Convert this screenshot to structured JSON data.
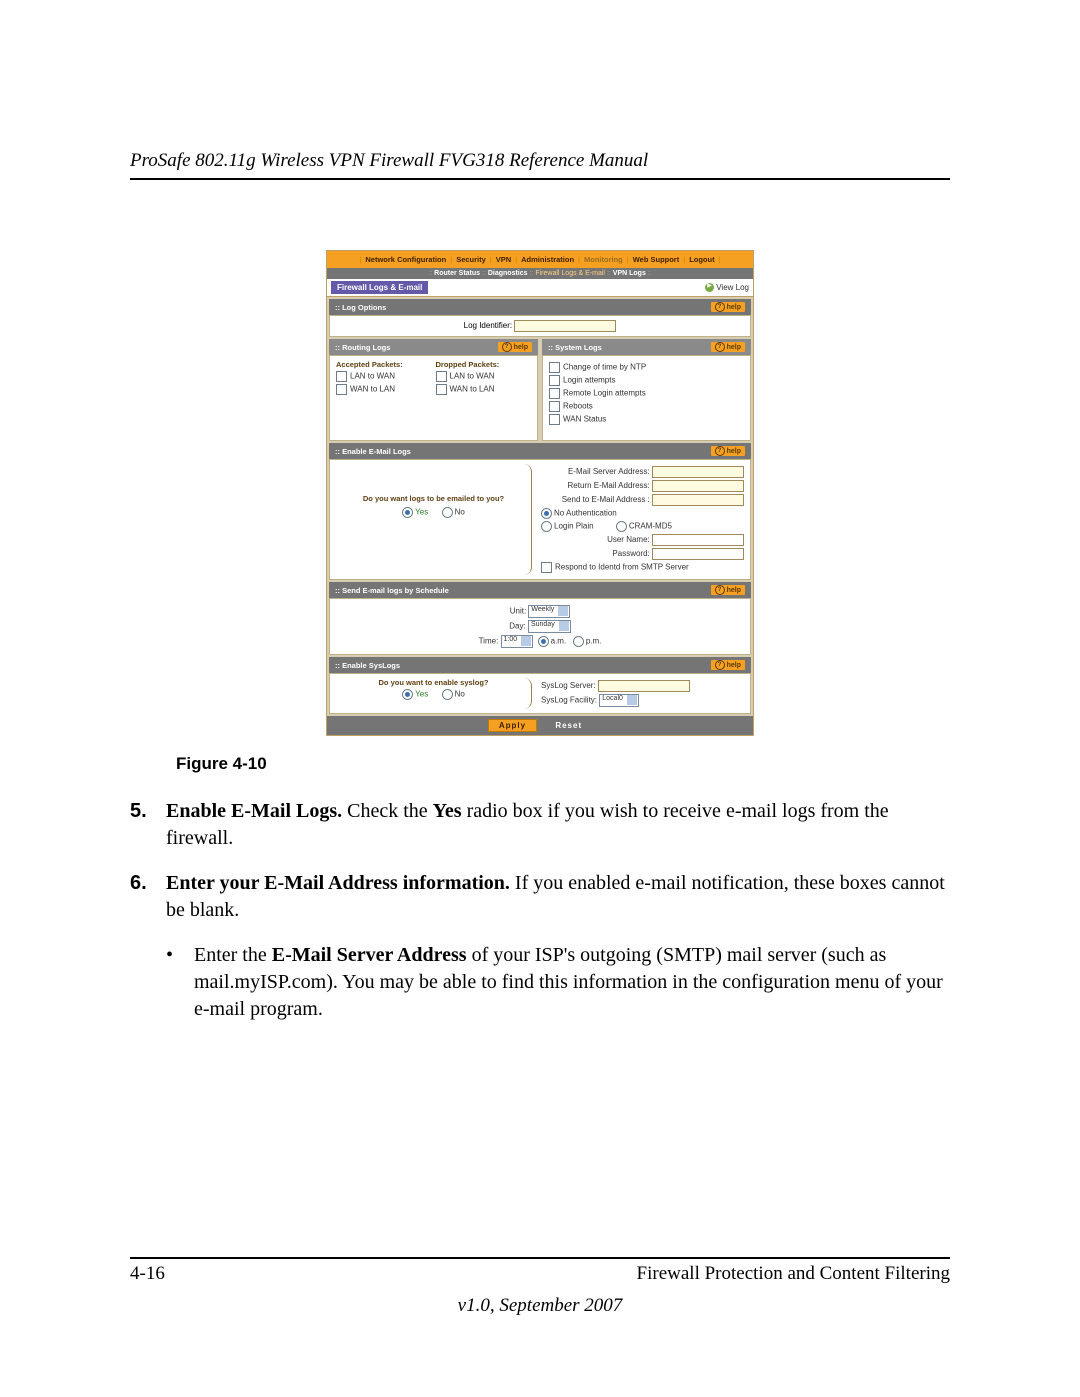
{
  "doc_title": "ProSafe 802.11g Wireless VPN Firewall FVG318 Reference Manual",
  "topnav": {
    "items": [
      "Network Configuration",
      "Security",
      "VPN",
      "Administration",
      "Monitoring",
      "Web Support",
      "Logout"
    ]
  },
  "subnav": {
    "items": [
      "Router Status",
      "Diagnostics",
      "Firewall Logs & E-mail",
      "VPN Logs"
    ]
  },
  "page_title": "Firewall Logs & E-mail",
  "view_log": "View Log",
  "help": "help",
  "section_log_options": {
    "title": "Log Options",
    "label": "Log Identifier:"
  },
  "section_routing": {
    "title": "Routing Logs",
    "col1": "Accepted Packets:",
    "col2": "Dropped Packets:",
    "opt1": "LAN to WAN",
    "opt2": "WAN to LAN"
  },
  "section_system": {
    "title": "System Logs",
    "o1": "Change of time by NTP",
    "o2": "Login attempts",
    "o3": "Remote Login attempts",
    "o4": "Reboots",
    "o5": "WAN Status"
  },
  "section_email": {
    "title": "Enable E-Mail Logs",
    "q": "Do you want logs to be emailed to you?",
    "yes": "Yes",
    "no": "No",
    "f1": "E-Mail Server Address:",
    "f2": "Return E-Mail Address:",
    "f3": "Send to E-Mail Address :",
    "auth_none": "No Authentication",
    "auth_plain": "Login Plain",
    "auth_cram": "CRAM-MD5",
    "user": "User Name:",
    "pass": "Password:",
    "identd": "Respond to Identd from SMTP Server"
  },
  "section_schedule": {
    "title": "Send E-mail logs by Schedule",
    "unit": "Unit:",
    "unit_v": "Weekly",
    "day": "Day:",
    "day_v": "Sunday",
    "time": "Time:",
    "time_v": "1:00",
    "am": "a.m.",
    "pm": "p.m."
  },
  "section_syslog": {
    "title": "Enable SysLogs",
    "q": "Do you want to enable syslog?",
    "yes": "Yes",
    "no": "No",
    "server": "SysLog Server:",
    "facility": "SysLog Facility:",
    "facility_v": "Local0"
  },
  "buttons": {
    "apply": "Apply",
    "reset": "Reset"
  },
  "figure_caption": "Figure 4-10",
  "step5": {
    "num": "5.",
    "b1": "Enable E-Mail Logs.",
    "t1": " Check the ",
    "b2": "Yes",
    "t2": " radio box if you wish to receive e-mail logs from the firewall."
  },
  "step6": {
    "num": "6.",
    "b1": "Enter your E-Mail Address information.",
    "t1": " If you enabled e-mail notification, these boxes cannot be blank."
  },
  "step6a": {
    "t1": "Enter the ",
    "b1": "E-Mail Server Address",
    "t2": " of your ISP's outgoing (SMTP) mail server (such as mail.myISP.com). You may be able to find this information in the configuration menu of your e-mail program."
  },
  "footer": {
    "left": "4-16",
    "right": "Firewall Protection and Content Filtering",
    "version": "v1.0, September 2007"
  }
}
